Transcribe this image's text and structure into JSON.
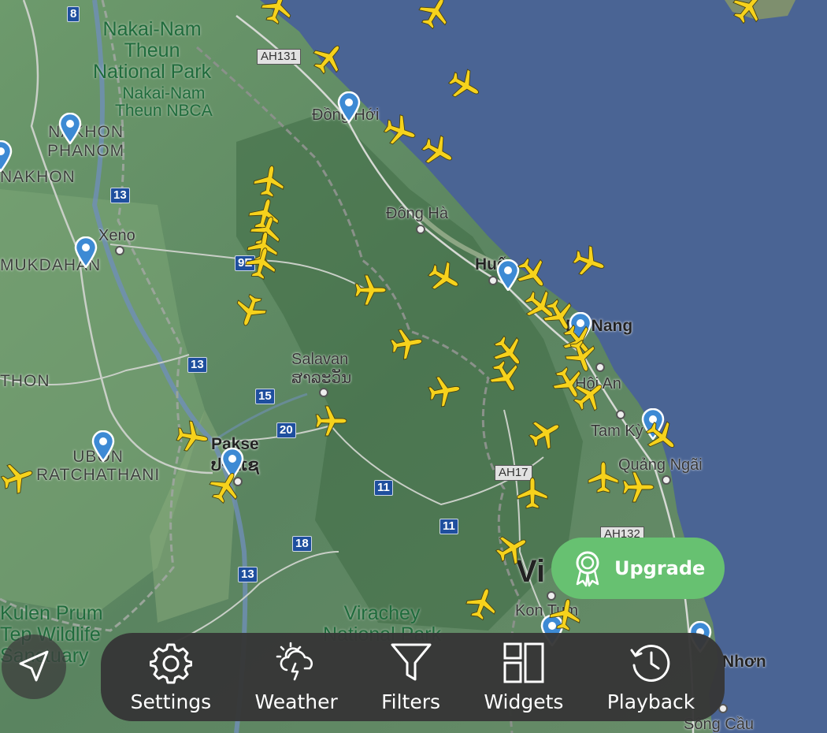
{
  "map": {
    "parks": [
      {
        "label": "Nakai-Nam\nTheun\nNational Park",
        "kind": "large"
      },
      {
        "label": "Nakai-Nam\nTheun NBCA",
        "kind": "small"
      },
      {
        "label": "Kulen Prum\nTep Wildlife\nSanctuary",
        "kind": "large"
      },
      {
        "label": "Virachey\nNational Park",
        "kind": "large"
      }
    ],
    "places": {
      "nakhon_phanom": "NAKHON\nPHANOM",
      "nakhon": "NAKHON",
      "mukdahan": "MUKDAHAN",
      "xeno": "Xeno",
      "dong_hoi": "Đồng Hới",
      "dong_ha": "Đông Hà",
      "hue": "Huế",
      "da_nang": "Da Nang",
      "hoi_an": "Hội An",
      "tam_ky": "Tam Kỳ",
      "quang_ngai": "Quảng Ngãi",
      "salavan": "Salavan",
      "salavan_lao": "ສາລະວັນ",
      "thon": "THON",
      "ubon": "UBON\nRATCHATHANI",
      "pakse": "Pakse",
      "pakse_lao": "ປາກເຊ",
      "vietnam_partial": "Vi",
      "kon_tum": "Kon Tum",
      "nhon": "Nhơn",
      "song_cau": "Sông Cầu"
    },
    "road_shields": [
      "8",
      "13",
      "9E",
      "13",
      "15",
      "20",
      "11",
      "11",
      "18",
      "13"
    ],
    "asian_highways": [
      "AH131",
      "AH17",
      "AH132"
    ]
  },
  "upgrade": {
    "label": "Upgrade"
  },
  "toolbar": {
    "items": [
      {
        "label": "Settings",
        "icon": "gear-icon"
      },
      {
        "label": "Weather",
        "icon": "weather-icon"
      },
      {
        "label": "Filters",
        "icon": "filter-icon"
      },
      {
        "label": "Widgets",
        "icon": "widgets-icon"
      },
      {
        "label": "Playback",
        "icon": "playback-icon"
      }
    ]
  },
  "colors": {
    "sea": "#4a6494",
    "land": "#5f8562",
    "plane": "#f6d21c",
    "pin": "#3d8ad4",
    "upgrade": "#67c171",
    "toolbar": "#363636"
  }
}
